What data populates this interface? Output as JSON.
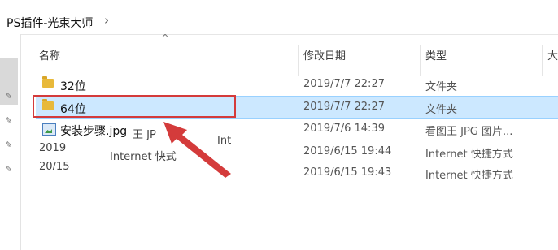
{
  "breadcrumb": {
    "path": "PS插件-光束大师",
    "chevron": "›"
  },
  "nav": {
    "pins": [
      "pin-icon",
      "pin-icon",
      "pin-icon",
      "pin-icon",
      "pin-icon"
    ]
  },
  "columns": {
    "name": "名称",
    "modified": "修改日期",
    "type": "类型",
    "size": "大"
  },
  "files": [
    {
      "name": "32位",
      "date": "2019/7/7 22:27",
      "type": "文件夹",
      "icon": "folder-icon",
      "selected": false
    },
    {
      "name": "64位",
      "date": "2019/7/7 22:27",
      "type": "文件夹",
      "icon": "folder-icon",
      "selected": true
    },
    {
      "name": "安装步骤.jpg",
      "date": "2019/7/6 14:39",
      "type": "看图王 JPG 图片...",
      "icon": "image-icon",
      "selected": false
    },
    {
      "name": "",
      "date": "2019/6/15 19:44",
      "type": "Internet 快捷方式",
      "icon": "shortcut-icon",
      "selected": false
    },
    {
      "name": "",
      "date": "2019/6/15 19:43",
      "type": "Internet 快捷方式",
      "icon": "shortcut-icon",
      "selected": false
    }
  ],
  "ghost_text": {
    "a": "王 JP",
    "b": "Int",
    "c": "2019",
    "d": "Internet 快式",
    "e": "20/15"
  },
  "colors": {
    "selection": "#cce8ff",
    "annotation": "#d43b3b",
    "folder": "#e8b93a"
  }
}
